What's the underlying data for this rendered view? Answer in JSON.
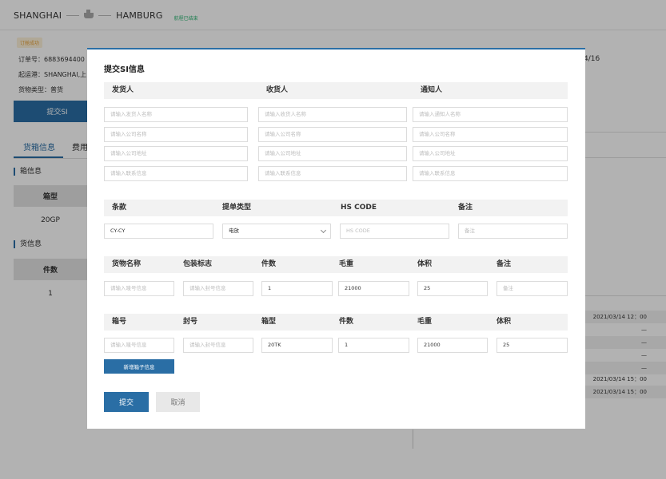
{
  "background": {
    "route": {
      "origin": "SHANGHAI",
      "destination": "HAMBURG",
      "status": "航程已结束"
    },
    "badge": "订舱成功",
    "order_no": "订单号：6883694400",
    "pol": "起运港：SHANGHAI,上",
    "cargo_type": "货物类型：普货",
    "submit_si_label": "提交SI",
    "tabs": [
      "货箱信息",
      "费用"
    ],
    "box_section": {
      "title": "箱信息",
      "header": "箱型",
      "value": "20GP"
    },
    "cargo_section": {
      "title": "货信息",
      "header": "件数",
      "value": "1"
    },
    "right_date_top": "4/16",
    "right_rows": [
      "2021/03/14  12：00",
      "—",
      "—",
      "—",
      "—",
      "2021/03/14  15：00",
      "2021/03/14  15：00"
    ]
  },
  "modal": {
    "title": "提交SI信息",
    "parties": {
      "headers": [
        "发货人",
        "收货人",
        "通知人"
      ],
      "rows": [
        [
          "请输入发货人名称",
          "请输入收货人名称",
          "请输入通知人名称"
        ],
        [
          "请输入公司名称",
          "请输入公司名称",
          "请输入公司名称"
        ],
        [
          "请输入公司地址",
          "请输入公司地址",
          "请输入公司地址"
        ],
        [
          "请输入联系信息",
          "请输入联系信息",
          "请输入联系信息"
        ]
      ]
    },
    "terms": {
      "headers": [
        "条款",
        "提单类型",
        "HS CODE",
        "备注"
      ],
      "values": [
        "CY-CY",
        "电放",
        "HS CODE",
        "备注"
      ]
    },
    "goods": {
      "headers": [
        "货物名称",
        "包装标志",
        "件数",
        "毛重",
        "体积",
        "备注"
      ],
      "values": [
        "请输入唛号信息",
        "请输入封号信息",
        "1",
        "21000",
        "25",
        "备注"
      ]
    },
    "containers": {
      "headers": [
        "箱号",
        "封号",
        "箱型",
        "件数",
        "毛重",
        "体积"
      ],
      "values": [
        "请输入唛号信息",
        "请输入封号信息",
        "20TK",
        "1",
        "21000",
        "25"
      ]
    },
    "add_container_label": "新增箱子信息",
    "submit_label": "提交",
    "cancel_label": "取消"
  }
}
